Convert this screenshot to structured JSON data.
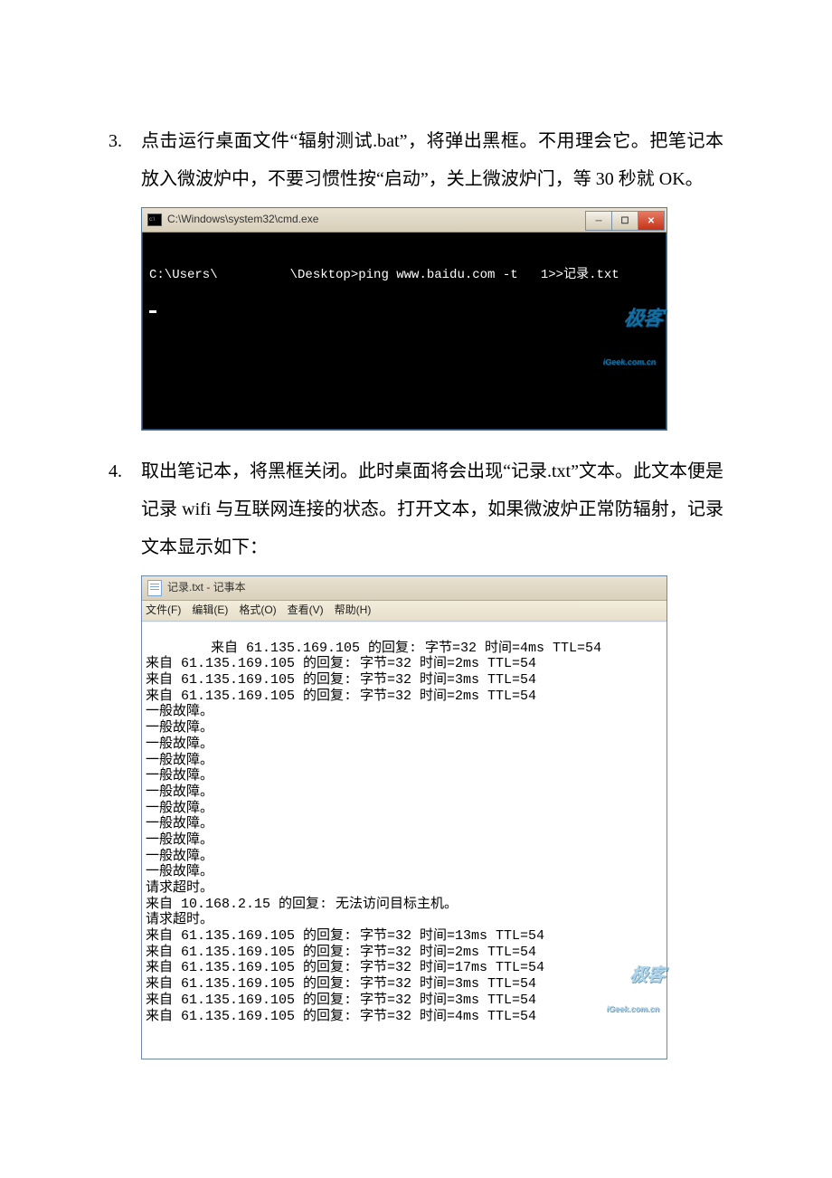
{
  "para3": {
    "num": "3.",
    "text": "点击运行桌面文件“辐射测试.bat”，将弹出黑框。不用理会它。把笔记本放入微波炉中，不要习惯性按“启动”，关上微波炉门，等 30 秒就 OK。"
  },
  "cmd_window": {
    "title": "C:\\Windows\\system32\\cmd.exe",
    "line_prefix": "C:\\Users\\",
    "line_cmd": "\\Desktop>ping www.baidu.com -t   1>>记录.txt",
    "watermark_main": "极客",
    "watermark_sub": "iGeek.com.cn"
  },
  "para4": {
    "num": "4.",
    "text": "取出笔记本，将黑框关闭。此时桌面将会出现“记录.txt”文本。此文本便是记录 wifi 与互联网连接的状态。打开文本，如果微波炉正常防辐射，记录文本显示如下："
  },
  "notepad": {
    "title": "记录.txt - 记事本",
    "menus": {
      "file": "文件(F)",
      "edit": "编辑(E)",
      "format": "格式(O)",
      "view": "查看(V)",
      "help": "帮助(H)"
    },
    "lines": [
      "来自 61.135.169.105 的回复: 字节=32 时间=4ms TTL=54",
      "来自 61.135.169.105 的回复: 字节=32 时间=2ms TTL=54",
      "来自 61.135.169.105 的回复: 字节=32 时间=3ms TTL=54",
      "来自 61.135.169.105 的回复: 字节=32 时间=2ms TTL=54",
      "一般故障。",
      "一般故障。",
      "一般故障。",
      "一般故障。",
      "一般故障。",
      "一般故障。",
      "一般故障。",
      "一般故障。",
      "一般故障。",
      "一般故障。",
      "一般故障。",
      "请求超时。",
      "来自 10.168.2.15 的回复: 无法访问目标主机。",
      "请求超时。",
      "来自 61.135.169.105 的回复: 字节=32 时间=13ms TTL=54",
      "来自 61.135.169.105 的回复: 字节=32 时间=2ms TTL=54",
      "来自 61.135.169.105 的回复: 字节=32 时间=17ms TTL=54",
      "来自 61.135.169.105 的回复: 字节=32 时间=3ms TTL=54",
      "来自 61.135.169.105 的回复: 字节=32 时间=3ms TTL=54",
      "来自 61.135.169.105 的回复: 字节=32 时间=4ms TTL=54"
    ]
  }
}
